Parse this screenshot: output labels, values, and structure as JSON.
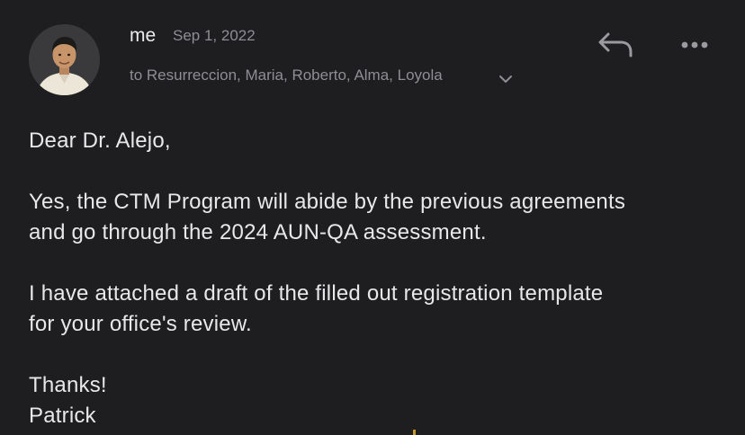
{
  "message": {
    "sender": "me",
    "date": "Sep 1, 2022",
    "recipients": "to Resurreccion, Maria, Roberto, Alma, Loyola"
  },
  "actions": {
    "reply_icon": "reply-arrow",
    "more_icon": "ellipsis"
  },
  "body": {
    "greeting": "Dear Dr. Alejo,",
    "paragraph1_line1": "Yes, the CTM Program will abide by the previous agreements",
    "paragraph1_line2": "and go through the 2024 AUN-QA assessment.",
    "paragraph2_line1": "I have attached a draft of the filled out registration template",
    "paragraph2_line2": "for your office's review.",
    "closing": "Thanks!",
    "signature": "Patrick"
  },
  "colors": {
    "background": "#1e1e21",
    "primary_text": "#e8e8ea",
    "secondary_text": "#8e8e93"
  }
}
